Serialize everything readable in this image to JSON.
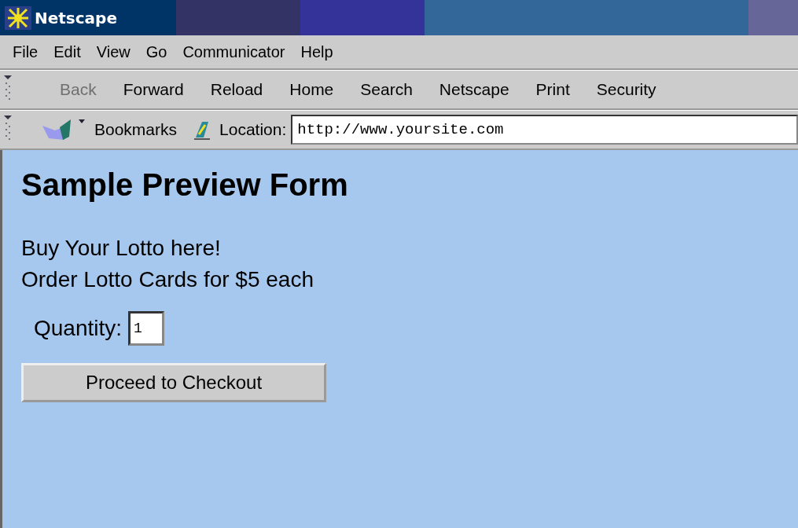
{
  "window": {
    "title": "Netscape"
  },
  "menu": [
    "File",
    "Edit",
    "View",
    "Go",
    "Communicator",
    "Help"
  ],
  "toolbar": [
    {
      "label": "Back",
      "disabled": true
    },
    {
      "label": "Forward",
      "disabled": false
    },
    {
      "label": "Reload",
      "disabled": false
    },
    {
      "label": "Home",
      "disabled": false
    },
    {
      "label": "Search",
      "disabled": false
    },
    {
      "label": "Netscape",
      "disabled": false
    },
    {
      "label": "Print",
      "disabled": false
    },
    {
      "label": "Security",
      "disabled": false
    }
  ],
  "location_bar": {
    "bookmarks": "Bookmarks",
    "label": "Location:",
    "url": "http://www.yoursite.com"
  },
  "page": {
    "heading": "Sample Preview Form",
    "lines": [
      "Buy Your Lotto here!",
      "Order Lotto Cards for $5 each"
    ],
    "quantity_label": "Quantity:",
    "quantity_value": "1",
    "button": "Proceed to Checkout"
  }
}
